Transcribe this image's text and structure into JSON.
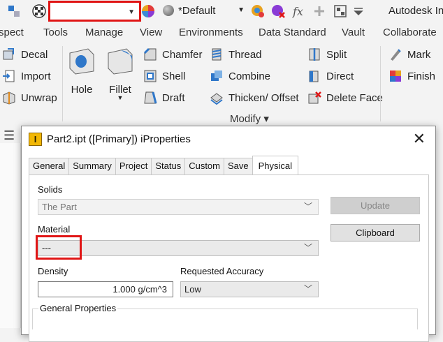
{
  "qat": {
    "appearance_value": "",
    "style_value": "*Default",
    "app_title": "Autodesk In"
  },
  "ribbon_tabs": [
    "spect",
    "Tools",
    "Manage",
    "View",
    "Environments",
    "Data Standard",
    "Vault",
    "Collaborate"
  ],
  "ribbon": {
    "decal": "Decal",
    "import": "Import",
    "unwrap": "Unwrap",
    "hole": "Hole",
    "fillet": "Fillet",
    "chamfer": "Chamfer",
    "shell": "Shell",
    "draft": "Draft",
    "thread": "Thread",
    "combine": "Combine",
    "thicken": "Thicken/ Offset",
    "split": "Split",
    "direct": "Direct",
    "delete_face": "Delete Face",
    "mark": "Mark",
    "finish": "Finish",
    "panel_label": "Modify ▾"
  },
  "dialog": {
    "title": "Part2.ipt ([Primary]) iProperties",
    "logo_letter": "I",
    "close": "✕",
    "tabs": [
      "General",
      "Summary",
      "Project",
      "Status",
      "Custom",
      "Save",
      "Physical"
    ],
    "active_tab": "Physical",
    "solids_label": "Solids",
    "solids_value": "The Part",
    "update_button": "Update",
    "clipboard_button": "Clipboard",
    "material_label": "Material",
    "material_value": "---",
    "density_label": "Density",
    "density_value": "1.000 g/cm^3",
    "accuracy_label": "Requested Accuracy",
    "accuracy_value": "Low",
    "general_properties_label": "General Properties"
  },
  "colors": {
    "highlight": "#e01515",
    "ribbon_bg": "#f3f3f3",
    "accent_blue": "#1f6fb5"
  }
}
